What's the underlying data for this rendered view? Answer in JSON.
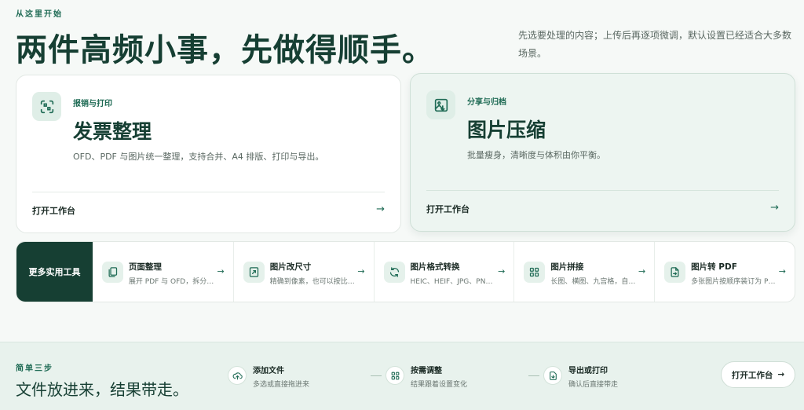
{
  "hero": {
    "eyebrow": "从这里开始",
    "title": "两件高频小事，先做得顺手。",
    "description": "先选要处理的内容；上传后再逐项微调，默认设置已经适合大多数场景。"
  },
  "cards": [
    {
      "icon": "invoice-scan-icon",
      "tag": "报销与打印",
      "title": "发票整理",
      "description": "OFD、PDF 与图片统一整理，支持合并、A4 排版、打印与导出。",
      "cta": "打开工作台"
    },
    {
      "icon": "image-compress-icon",
      "tag": "分享与归档",
      "title": "图片压缩",
      "description": "批量瘦身，清晰度与体积由你平衡。",
      "cta": "打开工作台"
    }
  ],
  "tools": {
    "lead_label": "更多实用工具",
    "items": [
      {
        "icon": "pages-icon",
        "title": "页面整理",
        "description": "展开 PDF 与 OFD，拆分、排序与删除页面"
      },
      {
        "icon": "resize-image-icon",
        "title": "图片改尺寸",
        "description": "精确到像素，也可以按比例缩放"
      },
      {
        "icon": "convert-icon",
        "title": "图片格式转换",
        "description": "HEIC、HEIF、JPG、PNG 之间互相转换"
      },
      {
        "icon": "grid-icon",
        "title": "图片拼接",
        "description": "长图、横图、九宫格，自由拼接"
      },
      {
        "icon": "image-to-pdf-icon",
        "title": "图片转 PDF",
        "description": "多张图片按顺序装订为 PDF 文件"
      }
    ]
  },
  "steps": {
    "eyebrow": "简单三步",
    "title": "文件放进来，结果带走。",
    "items": [
      {
        "icon": "upload-cloud-icon",
        "title": "添加文件",
        "description": "多选或直接拖进来"
      },
      {
        "icon": "adjust-icon",
        "title": "按需调整",
        "description": "结果跟着设置变化"
      },
      {
        "icon": "export-icon",
        "title": "导出或打印",
        "description": "确认后直接带走"
      }
    ],
    "button_label": "打开工作台"
  },
  "colors": {
    "brand_dark": "#163f33",
    "accent": "#1f6b55",
    "icon_bg": "#dfeee7"
  }
}
